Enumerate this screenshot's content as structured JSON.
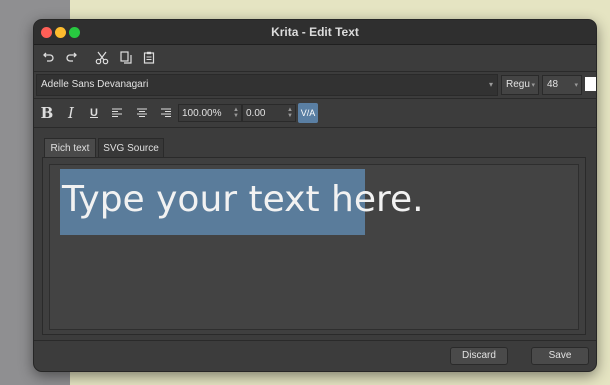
{
  "window": {
    "title": "Krita - Edit Text"
  },
  "toolbar": {
    "undo_icon": "undo-icon",
    "redo_icon": "redo-icon",
    "cut_icon": "cut-icon",
    "copy_icon": "copy-icon",
    "paste_icon": "paste-icon"
  },
  "font_row": {
    "font_family": "Adelle Sans Devanagari",
    "font_style": "Regu",
    "font_size": "48",
    "text_color": "#ffffff",
    "picker_icon": "eyedropper-icon"
  },
  "format_row": {
    "bold": "B",
    "italic": "I",
    "underline": "U",
    "line_height": "100.00%",
    "letter_spacing": "0.00",
    "kerning_label": "V/A"
  },
  "tabs": [
    {
      "label": "Rich text",
      "active": true
    },
    {
      "label": "SVG Source",
      "active": false
    }
  ],
  "editor": {
    "text": "Type your text here.",
    "selection_color": "#5a7c9b"
  },
  "buttons": {
    "discard": "Discard",
    "save": "Save"
  }
}
